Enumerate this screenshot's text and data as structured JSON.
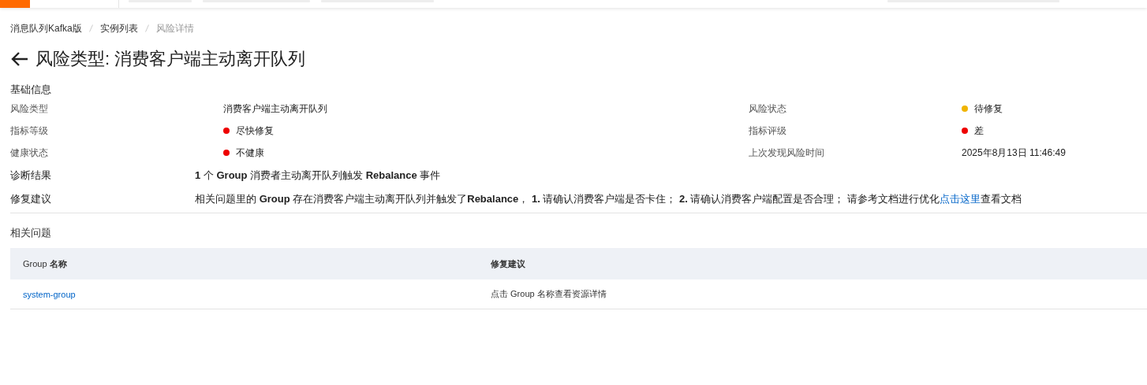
{
  "breadcrumb": [
    {
      "label": "消息队列Kafka版",
      "current": false
    },
    {
      "label": "实例列表",
      "current": false
    },
    {
      "label": "风险详情",
      "current": true
    }
  ],
  "title": "风险类型: 消费客户端主动离开队列",
  "basic_info": {
    "heading": "基础信息",
    "fields": [
      {
        "label": "风险类型",
        "value": "消费客户端主动离开队列"
      },
      {
        "label": "风险状态",
        "value": "待修复",
        "color": "#f0b400"
      },
      {
        "label": "指标等级",
        "value": "尽快修复",
        "color": "#ee0000"
      },
      {
        "label": "指标评级",
        "value": "差",
        "color": "#ee0000"
      },
      {
        "label": "健康状态",
        "value": "不健康",
        "color": "#ee0000"
      },
      {
        "label": "上次发现风险时间",
        "value": "2025年8月13日 11:46:49"
      }
    ]
  },
  "diagnosis": {
    "label": "诊断结果",
    "text": "**1** 个 **Group** 消费者主动离开队列触发 **Rebalance** 事件"
  },
  "suggestion": {
    "label": "修复建议",
    "text": "相关问题里的 **Group** 存在消费客户端主动离开队列并触发了**Rebalance**， **1.** 请确认消费客户端是否卡住； **2.** 请确认消费客户端配置是否合理； 请参考文档进行优化",
    "link": "点击这里",
    "after": "查看文档"
  },
  "related": {
    "heading": "相关问题",
    "columns": [
      "Group **名称**",
      "**修复建议**"
    ],
    "rows": [
      {
        "group": "system-group",
        "advice": "点击 Group 名称查看资源详情"
      }
    ]
  }
}
